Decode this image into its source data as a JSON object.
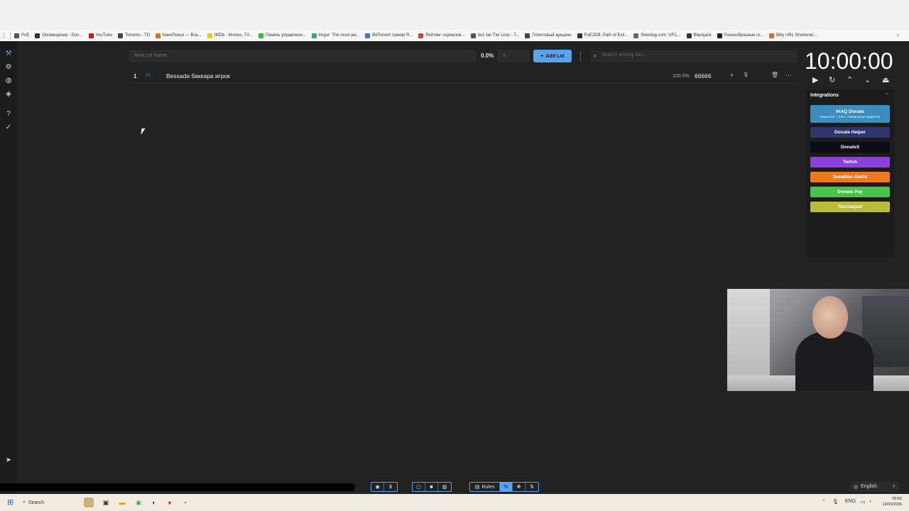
{
  "bookmarks": [
    {
      "label": "PoE",
      "color": "#555555"
    },
    {
      "label": "Оповещения - Don...",
      "color": "#333333"
    },
    {
      "label": "YouTube",
      "color": "#ff0000"
    },
    {
      "label": "Torrents - TD",
      "color": "#444444"
    },
    {
      "label": "КиноПоиск — Все...",
      "color": "#ff6600"
    },
    {
      "label": "IMDb - Movies, TV...",
      "color": "#f5c518"
    },
    {
      "label": "Панель управлени...",
      "color": "#2fbf3f"
    },
    {
      "label": "Imgur: The most aw...",
      "color": "#1bb76e"
    },
    {
      "label": "BitTorrent трекер R...",
      "color": "#4a76c6"
    },
    {
      "label": "Рейтинг сериалов...",
      "color": "#e53935"
    },
    {
      "label": "№1 fan Tier Lists - T...",
      "color": "#555555"
    },
    {
      "label": "Политовый аукцион",
      "color": "#444444"
    },
    {
      "label": "PoE2DB, Path of Exil...",
      "color": "#333333"
    },
    {
      "label": "Sherdog.com: UFC...",
      "color": "#666666"
    },
    {
      "label": "Blackjack",
      "color": "#333333"
    },
    {
      "label": "Разнообразные ог...",
      "color": "#222222"
    },
    {
      "label": "Bitly URL Shortener...",
      "color": "#ee6123"
    }
  ],
  "toolbar": {
    "lot_name_placeholder": "New Lot Name",
    "percent": "0.0%",
    "amount_placeholder": "$",
    "add_lot_label": "Add Lot",
    "search_placeholder": "Search among lots..."
  },
  "lots": [
    {
      "number": "1",
      "id": "#1",
      "name": "Bessada баккара игрок",
      "percent": "100.0%",
      "amount": "66666"
    }
  ],
  "timer": {
    "display": "10:00:00"
  },
  "integrations": {
    "title": "Integrations",
    "main": {
      "label": "IHAQ Donate",
      "sub": "Комиссия – 3,5%. Уникальные виджеты!",
      "color": "#3a8dbd"
    },
    "items": [
      {
        "label": "Donate Helper",
        "color": "#2d3470"
      },
      {
        "label": "DonateX",
        "color": "#0b0b14"
      },
      {
        "label": "Twitch",
        "color": "#8c3fe0"
      },
      {
        "label": "Donation Alerts",
        "color": "#f0781c"
      },
      {
        "label": "Donate Pay",
        "color": "#48c34a"
      },
      {
        "label": "Tournaquet",
        "color": "#b8ba3a"
      }
    ]
  },
  "bottom": {
    "rules_label": "Rules",
    "language": "English"
  },
  "taskbar": {
    "search_label": "Search",
    "lang": "ENG",
    "time": "20:52",
    "date": "12/03/2026"
  }
}
